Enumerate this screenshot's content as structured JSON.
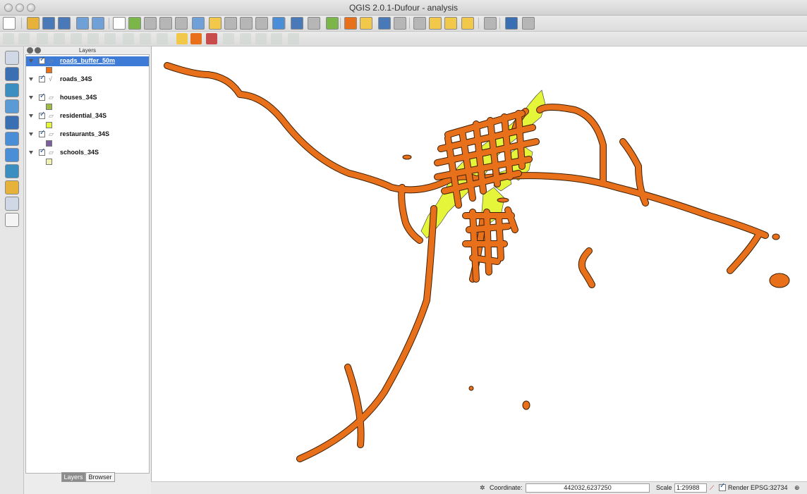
{
  "window": {
    "title": "QGIS 2.0.1-Dufour - analysis"
  },
  "layers_panel": {
    "title": "Layers",
    "layers": [
      {
        "name": "roads_buffer_50m",
        "checked": true,
        "selected": true,
        "swatch": "#e8701a",
        "type": "polygon"
      },
      {
        "name": "roads_34S",
        "checked": true,
        "selected": false,
        "swatch": null,
        "type": "line"
      },
      {
        "name": "houses_34S",
        "checked": true,
        "selected": false,
        "swatch": "#9fbc46",
        "type": "polygon"
      },
      {
        "name": "residential_34S",
        "checked": true,
        "selected": false,
        "swatch": "#e5f53a",
        "type": "polygon"
      },
      {
        "name": "restaurants_34S",
        "checked": true,
        "selected": false,
        "swatch": "#7b5f9e",
        "type": "polygon"
      },
      {
        "name": "schools_34S",
        "checked": true,
        "selected": false,
        "swatch": "#f2f1b4",
        "type": "polygon"
      }
    ],
    "tabs": [
      "Layers",
      "Browser"
    ]
  },
  "statusbar": {
    "coordinate_label": "Coordinate:",
    "coordinate_value": "442032,6237250",
    "scale_label": "Scale",
    "scale_value": "1:29988",
    "render_label": "Render",
    "crs": "EPSG:32734"
  },
  "colors": {
    "buffer": "#e8701a",
    "buffer_outline": "#3c2005",
    "residential": "#e5f53a",
    "selection": "#3d7bd7"
  },
  "icons": {
    "toolbar": [
      "new-project-icon",
      "open-project-icon",
      "save-project-icon",
      "save-as-icon",
      "print-composer-icon",
      "composer-manager-icon",
      "pan-icon",
      "pan-to-selection-icon",
      "zoom-in-icon",
      "zoom-out-icon",
      "zoom-native-icon",
      "zoom-full-icon",
      "zoom-to-selection-icon",
      "zoom-to-layer-icon",
      "zoom-last-icon",
      "zoom-next-icon",
      "refresh-icon",
      "identify-icon",
      "measure-icon",
      "select-icon",
      "deselect-icon",
      "field-calculator-icon",
      "attribute-table-icon",
      "statistics-icon",
      "measure-line-icon",
      "annotation-icon",
      "new-bookmark-icon",
      "show-bookmarks-icon",
      "text-annotation-icon",
      "help-icon",
      "whats-this-icon"
    ],
    "left_tools": [
      "add-vector-layer-icon",
      "add-raster-layer-icon",
      "add-postgis-layer-icon",
      "add-spatialite-layer-icon",
      "add-mssql-layer-icon",
      "add-wms-layer-icon",
      "add-wcs-layer-icon",
      "add-wfs-layer-icon",
      "add-delimited-text-icon",
      "new-shapefile-icon",
      "remove-layer-icon"
    ]
  }
}
